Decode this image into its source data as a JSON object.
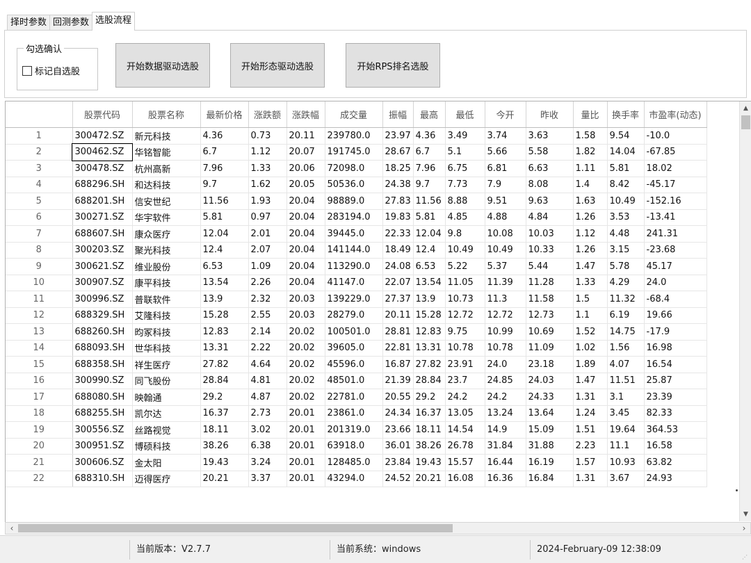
{
  "tabs": [
    "择时参数",
    "回测参数",
    "选股流程"
  ],
  "active_tab": 2,
  "group": {
    "title": "勾选确认",
    "checkbox_label": "标记自选股",
    "checked": false
  },
  "buttons": [
    "开始数据驱动选股",
    "开始形态驱动选股",
    "开始RPS排名选股"
  ],
  "table": {
    "columns": [
      "",
      "股票代码",
      "股票名称",
      "最新价格",
      "涨跌额",
      "涨跌幅",
      "成交量",
      "振幅",
      "最高",
      "最低",
      "今开",
      "昨收",
      "量比",
      "换手率",
      "市盈率(动态)"
    ],
    "rows": [
      [
        "1",
        "300472.SZ",
        "新元科技",
        "4.36",
        "0.73",
        "20.11",
        "239780.0",
        "23.97",
        "4.36",
        "3.49",
        "3.74",
        "3.63",
        "1.58",
        "9.54",
        "-10.0"
      ],
      [
        "2",
        "300462.SZ",
        "华铭智能",
        "6.7",
        "1.12",
        "20.07",
        "191745.0",
        "28.67",
        "6.7",
        "5.1",
        "5.66",
        "5.58",
        "1.82",
        "14.04",
        "-67.85"
      ],
      [
        "3",
        "300478.SZ",
        "杭州高新",
        "7.96",
        "1.33",
        "20.06",
        "72098.0",
        "18.25",
        "7.96",
        "6.75",
        "6.81",
        "6.63",
        "1.11",
        "5.81",
        "18.02"
      ],
      [
        "4",
        "688296.SH",
        "和达科技",
        "9.7",
        "1.62",
        "20.05",
        "50536.0",
        "24.38",
        "9.7",
        "7.73",
        "7.9",
        "8.08",
        "1.4",
        "8.42",
        "-45.17"
      ],
      [
        "5",
        "688201.SH",
        "信安世纪",
        "11.56",
        "1.93",
        "20.04",
        "98889.0",
        "27.83",
        "11.56",
        "8.88",
        "9.51",
        "9.63",
        "1.63",
        "10.49",
        "-152.16"
      ],
      [
        "6",
        "300271.SZ",
        "华宇软件",
        "5.81",
        "0.97",
        "20.04",
        "283194.0",
        "19.83",
        "5.81",
        "4.85",
        "4.88",
        "4.84",
        "1.26",
        "3.53",
        "-13.41"
      ],
      [
        "7",
        "688607.SH",
        "康众医疗",
        "12.04",
        "2.01",
        "20.04",
        "39445.0",
        "22.33",
        "12.04",
        "9.8",
        "10.08",
        "10.03",
        "1.12",
        "4.48",
        "241.31"
      ],
      [
        "8",
        "300203.SZ",
        "聚光科技",
        "12.4",
        "2.07",
        "20.04",
        "141144.0",
        "18.49",
        "12.4",
        "10.49",
        "10.49",
        "10.33",
        "1.26",
        "3.15",
        "-23.68"
      ],
      [
        "9",
        "300621.SZ",
        "维业股份",
        "6.53",
        "1.09",
        "20.04",
        "113290.0",
        "24.08",
        "6.53",
        "5.22",
        "5.37",
        "5.44",
        "1.47",
        "5.78",
        "45.17"
      ],
      [
        "10",
        "300907.SZ",
        "康平科技",
        "13.54",
        "2.26",
        "20.04",
        "41147.0",
        "22.07",
        "13.54",
        "11.05",
        "11.39",
        "11.28",
        "1.33",
        "4.29",
        "24.0"
      ],
      [
        "11",
        "300996.SZ",
        "普联软件",
        "13.9",
        "2.32",
        "20.03",
        "139229.0",
        "27.37",
        "13.9",
        "10.73",
        "11.3",
        "11.58",
        "1.5",
        "11.32",
        "-68.4"
      ],
      [
        "12",
        "688329.SH",
        "艾隆科技",
        "15.28",
        "2.55",
        "20.03",
        "28279.0",
        "20.11",
        "15.28",
        "12.72",
        "12.72",
        "12.73",
        "1.1",
        "6.19",
        "19.66"
      ],
      [
        "13",
        "688260.SH",
        "昀冢科技",
        "12.83",
        "2.14",
        "20.02",
        "100501.0",
        "28.81",
        "12.83",
        "9.75",
        "10.99",
        "10.69",
        "1.52",
        "14.75",
        "-17.9"
      ],
      [
        "14",
        "688093.SH",
        "世华科技",
        "13.31",
        "2.22",
        "20.02",
        "39605.0",
        "22.81",
        "13.31",
        "10.78",
        "10.78",
        "11.09",
        "1.02",
        "1.56",
        "16.98"
      ],
      [
        "15",
        "688358.SH",
        "祥生医疗",
        "27.82",
        "4.64",
        "20.02",
        "45596.0",
        "16.87",
        "27.82",
        "23.91",
        "24.0",
        "23.18",
        "1.89",
        "4.07",
        "16.54"
      ],
      [
        "16",
        "300990.SZ",
        "同飞股份",
        "28.84",
        "4.81",
        "20.02",
        "48501.0",
        "21.39",
        "28.84",
        "23.7",
        "24.85",
        "24.03",
        "1.47",
        "11.51",
        "25.87"
      ],
      [
        "17",
        "688080.SH",
        "映翰通",
        "29.2",
        "4.87",
        "20.02",
        "22781.0",
        "20.55",
        "29.2",
        "24.2",
        "24.2",
        "24.33",
        "1.31",
        "3.1",
        "23.39"
      ],
      [
        "18",
        "688255.SH",
        "凯尔达",
        "16.37",
        "2.73",
        "20.01",
        "23861.0",
        "24.34",
        "16.37",
        "13.05",
        "13.24",
        "13.64",
        "1.24",
        "3.45",
        "82.33"
      ],
      [
        "19",
        "300556.SZ",
        "丝路视觉",
        "18.11",
        "3.02",
        "20.01",
        "201319.0",
        "23.66",
        "18.11",
        "14.54",
        "14.9",
        "15.09",
        "1.51",
        "19.64",
        "364.53"
      ],
      [
        "20",
        "300951.SZ",
        "博硕科技",
        "38.26",
        "6.38",
        "20.01",
        "63918.0",
        "36.01",
        "38.26",
        "26.78",
        "31.84",
        "31.88",
        "2.23",
        "11.1",
        "16.58"
      ],
      [
        "21",
        "300606.SZ",
        "金太阳",
        "19.43",
        "3.24",
        "20.01",
        "128485.0",
        "23.84",
        "19.43",
        "15.57",
        "16.44",
        "16.19",
        "1.57",
        "10.93",
        "63.82"
      ],
      [
        "22",
        "688310.SH",
        "迈得医疗",
        "20.21",
        "3.37",
        "20.01",
        "43294.0",
        "24.52",
        "20.21",
        "16.08",
        "16.36",
        "16.84",
        "1.31",
        "3.67",
        "24.93"
      ]
    ]
  },
  "status": {
    "version": "当前版本：V2.7.7",
    "system": "当前系统：windows",
    "datetime": "2024-February-09 12:38:09"
  }
}
